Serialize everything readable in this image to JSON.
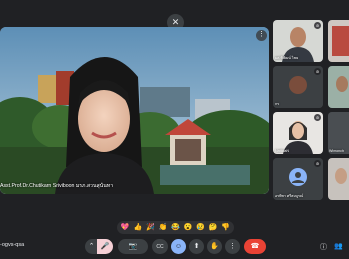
{
  "meeting": {
    "code": "-ogvs-qsa"
  },
  "main_speaker": {
    "name": "Asst.Prof.Dr.Chutikarn Sriviboon มรภ.สวนสุนันทา"
  },
  "participants": [
    {
      "name": "ผศ.พิพัฒน์ ไชย"
    },
    {
      "name": "กร"
    },
    {
      "name": "ภวิศา ลาภมงคลศักดิ์"
    },
    {
      "name": ""
    },
    {
      "name": "NattidaN"
    },
    {
      "name": "Wimonch"
    },
    {
      "name": "อรพิชา ศรีสมบูรณ์"
    }
  ],
  "reactions": [
    "💖",
    "👍",
    "🎉",
    "👏",
    "😂",
    "😮",
    "😢",
    "🤔",
    "👎"
  ],
  "controls": {
    "mic_off": "🎤",
    "more_audio": "⌃",
    "camera": "📷",
    "captions": "CC",
    "emoji": "☺",
    "present": "⬆",
    "hand": "✋",
    "more": "⋮",
    "end_call": "☎"
  },
  "colors": {
    "end_call": "#ea4335",
    "active": "#8ab4f8",
    "background": "#202124"
  }
}
